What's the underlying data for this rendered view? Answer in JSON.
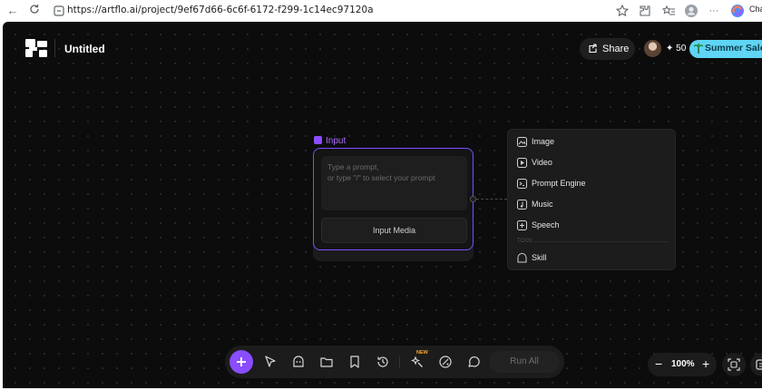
{
  "browser": {
    "url": "https://artflo.ai/project/9ef67d66-6c6f-6172-f299-1c14ec97120a",
    "chat_label": "Chat"
  },
  "header": {
    "doc_title": "Untitled",
    "share_label": "Share",
    "credits": "50",
    "sale_label": "Summer Sale"
  },
  "node": {
    "label": "Input",
    "prompt_placeholder_line1": "Type a prompt,",
    "prompt_placeholder_line2": "or type \"/\" to select your prompt",
    "media_button": "Input Media"
  },
  "menu": {
    "items": [
      {
        "label": "Image",
        "icon": "image-icon"
      },
      {
        "label": "Video",
        "icon": "video-icon"
      },
      {
        "label": "Prompt Engine",
        "icon": "prompt-engine-icon"
      },
      {
        "label": "Music",
        "icon": "music-icon"
      },
      {
        "label": "Speech",
        "icon": "speech-icon"
      }
    ],
    "section_label": "TOOL",
    "tool_items": [
      {
        "label": "Skill",
        "icon": "skill-icon"
      }
    ]
  },
  "toolbar": {
    "new_badge": "NEW",
    "run_all": "Run All"
  },
  "zoom": {
    "minus": "−",
    "level": "100%",
    "plus": "+"
  },
  "colors": {
    "accent": "#8a4dff",
    "sale": "#5fd4f4",
    "canvas": "#0c0c0c"
  }
}
